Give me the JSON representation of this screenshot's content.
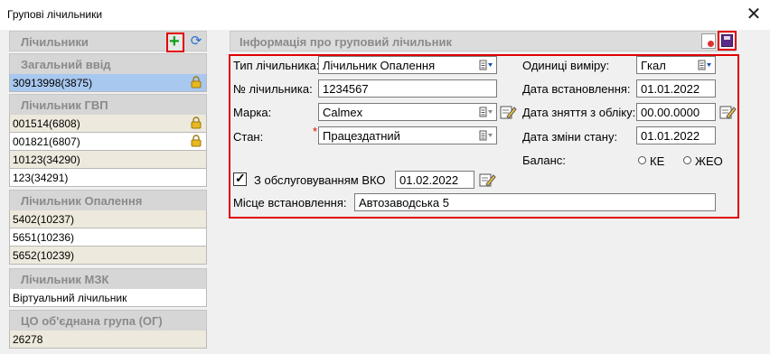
{
  "window": {
    "title": "Групові лічильники",
    "close_glyph": "✕"
  },
  "left_panel": {
    "header": "Лічильники",
    "groups": [
      {
        "label": "Загальний ввід",
        "items": [
          {
            "text": "30913998(3875)",
            "locked": true,
            "selected": true
          }
        ]
      },
      {
        "label": "Лічильник ГВП",
        "items": [
          {
            "text": "001514(6808)",
            "locked": true
          },
          {
            "text": "001821(6807)",
            "locked": true
          },
          {
            "text": "10123(34290)",
            "locked": false
          },
          {
            "text": "123(34291)",
            "locked": false
          }
        ]
      },
      {
        "label": "Лічильник Опалення",
        "items": [
          {
            "text": "5402(10237)"
          },
          {
            "text": "5651(10236)"
          },
          {
            "text": "5652(10239)"
          }
        ]
      },
      {
        "label": "Лічильник МЗК",
        "items": [
          {
            "text": "Віртуальний лічильник"
          }
        ]
      },
      {
        "label": "ЦО об'єднана група (ОГ)",
        "items": [
          {
            "text": "26278"
          }
        ]
      }
    ]
  },
  "right_panel": {
    "header": "Інформація про груповий лічильник",
    "fields": {
      "meter_type": {
        "label": "Тип лічильника:",
        "value": "Лічильник Опалення"
      },
      "meter_number": {
        "label": "№ лічильника:",
        "value": "1234567"
      },
      "brand": {
        "label": "Марка:",
        "value": "Calmex"
      },
      "state": {
        "label": "Стан:",
        "value": "Працездатний",
        "required": "*"
      },
      "units": {
        "label": "Одиниці виміру:",
        "value": "Гкал"
      },
      "install_date": {
        "label": "Дата встановлення:",
        "value": "01.01.2022"
      },
      "removal_date": {
        "label": "Дата зняття з обліку:",
        "value": "00.00.0000"
      },
      "state_change_date": {
        "label": "Дата зміни стану:",
        "value": "01.01.2022"
      },
      "balance": {
        "label": "Баланс:",
        "option_ke": "КЕ",
        "option_zheo": "ЖЕО"
      },
      "vko": {
        "label": "З обслуговуванням ВКО",
        "checked": true,
        "check_glyph": "✓",
        "date": "01.02.2022"
      },
      "location": {
        "label": "Місце встановлення:",
        "value": "Автозаводська 5"
      }
    }
  },
  "icons": {
    "add": "plus-icon",
    "refresh": "refresh-icon",
    "save": "save-icon",
    "lock": "lock-icon"
  },
  "colors": {
    "highlight": "#e00000",
    "selected_row": "#a9c8ef",
    "add_green": "#12a11b"
  }
}
